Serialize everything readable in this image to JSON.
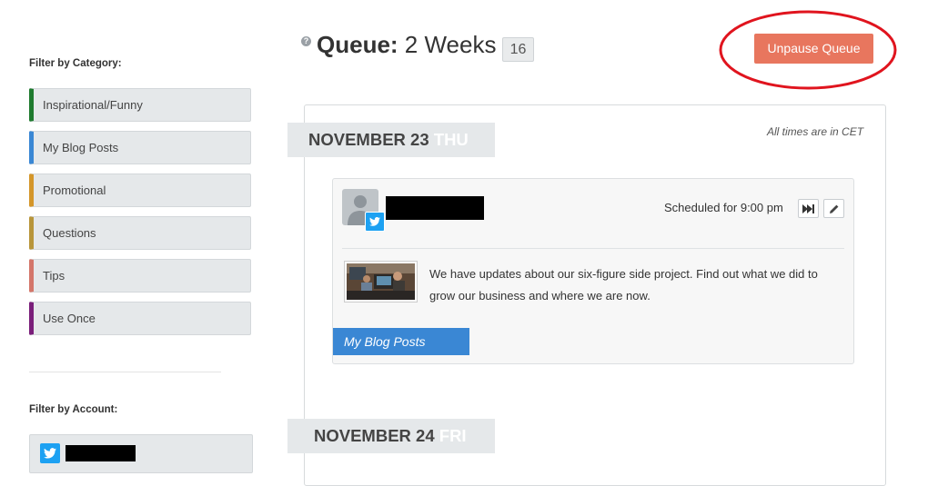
{
  "sidebar": {
    "category_heading": "Filter by Category:",
    "categories": [
      {
        "label": "Inspirational/Funny",
        "color": "#1e7a2e"
      },
      {
        "label": "My Blog Posts",
        "color": "#3a87d4"
      },
      {
        "label": "Promotional",
        "color": "#d4962a"
      },
      {
        "label": "Questions",
        "color": "#b8953a"
      },
      {
        "label": "Tips",
        "color": "#d4766a"
      },
      {
        "label": "Use Once",
        "color": "#7a1e7a"
      }
    ],
    "account_heading": "Filter by Account:"
  },
  "header": {
    "help_glyph": "?",
    "title_bold": "Queue:",
    "title_rest": " 2 Weeks",
    "count": "16",
    "unpause_label": "Unpause Queue"
  },
  "queue": {
    "timezone_note": "All times are in CET",
    "days": [
      {
        "date": "NOVEMBER 23",
        "weekday": "THU"
      },
      {
        "date": "NOVEMBER 24",
        "weekday": "FRI"
      }
    ],
    "post": {
      "network": "twitter-icon",
      "scheduled": "Scheduled for 9:00 pm",
      "text": "We have updates about our six-figure side project. Find out what we did to grow our business and where we are now.",
      "category": "My Blog Posts"
    }
  },
  "colors": {
    "accent_button": "#e8765e",
    "annotation": "#e0141e",
    "twitter": "#1da1f2",
    "category_tag": "#3a87d4"
  }
}
